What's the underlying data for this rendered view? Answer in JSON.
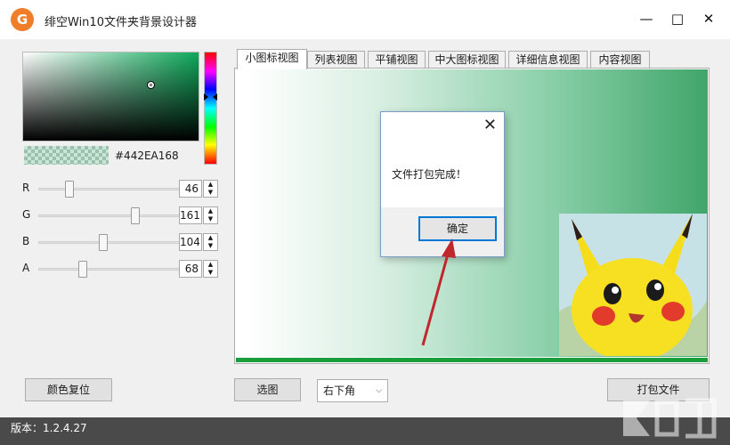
{
  "window": {
    "title": "绯空Win10文件夹背景设计器",
    "logo_letter": "G",
    "controls": [
      "—",
      "□",
      "✕"
    ]
  },
  "color_picker": {
    "hex": "#442EA168",
    "hue_color": "#0ea85a",
    "sliders": [
      {
        "label": "R",
        "value": "46",
        "fraction": 0.18
      },
      {
        "label": "G",
        "value": "161",
        "fraction": 0.63
      },
      {
        "label": "B",
        "value": "104",
        "fraction": 0.41
      },
      {
        "label": "A",
        "value": "68",
        "fraction": 0.27
      }
    ],
    "reset_label": "颜色复位"
  },
  "tabs": [
    {
      "label": "小图标视图",
      "active": true
    },
    {
      "label": "列表视图",
      "active": false
    },
    {
      "label": "平铺视图",
      "active": false
    },
    {
      "label": "中大图标视图",
      "active": false
    },
    {
      "label": "详细信息视图",
      "active": false
    },
    {
      "label": "内容视图",
      "active": false
    }
  ],
  "controls": {
    "select_image_label": "选图",
    "position_value": "右下角",
    "pack_label": "打包文件"
  },
  "dialog": {
    "message": "文件打包完成！",
    "ok_label": "确定",
    "close_glyph": "✕"
  },
  "status": {
    "version": "版本：1.2.4.27"
  },
  "colors": {
    "accent": "#0078d7",
    "arrow": "#c0272d",
    "status_bar": "#4a4a4a",
    "logo": "#f07d2a"
  }
}
